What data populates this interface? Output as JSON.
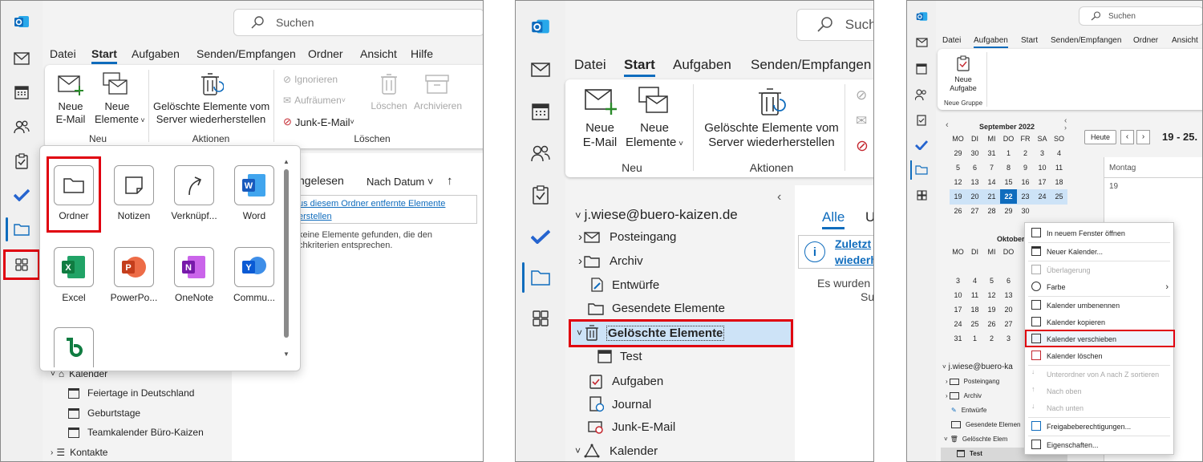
{
  "colors": {
    "accent": "#0f6cbd",
    "highlight": "#e0000f",
    "selected": "#cde3f7"
  },
  "panel1": {
    "search_placeholder": "Suchen",
    "tabs": [
      "Datei",
      "Start",
      "Aufgaben",
      "Senden/Empfangen",
      "Ordner",
      "Ansicht",
      "Hilfe"
    ],
    "ribbon": {
      "new_mail": [
        "Neue",
        "E-Mail"
      ],
      "new_items": [
        "Neue",
        "Elemente"
      ],
      "new_group": "Neu",
      "restore": [
        "Gelöschte Elemente vom",
        "Server wiederherstellen"
      ],
      "actions_group": "Aktionen",
      "ignore": "Ignorieren",
      "cleanup": "Aufräumen",
      "junk": "Junk-E-Mail",
      "delete": "Löschen",
      "archive": "Archivieren",
      "delete_group": "Löschen"
    },
    "list_header": {
      "unread": "ngelesen",
      "sort": "Nach Datum"
    },
    "info_link": [
      "us diesem Ordner entfernte Elemente",
      "erstellen"
    ],
    "empty_text": [
      "keine Elemente gefunden, die den",
      "chkriterien entsprechen."
    ],
    "tree": {
      "calendar": "Kalender",
      "items": [
        "Feiertage in Deutschland",
        "Geburtstage",
        "Teamkalender Büro-Kaizen"
      ],
      "contacts": "Kontakte"
    },
    "apps": [
      "Ordner",
      "Notizen",
      "Verknüpf...",
      "Word",
      "Excel",
      "PowerPo...",
      "OneNote",
      "Commu..."
    ]
  },
  "panel2": {
    "search_placeholder": "Suche",
    "tabs": [
      "Datei",
      "Start",
      "Aufgaben",
      "Senden/Empfangen"
    ],
    "ribbon": {
      "new_mail": [
        "Neue",
        "E-Mail"
      ],
      "new_items": [
        "Neue",
        "Elemente"
      ],
      "new_group": "Neu",
      "restore": [
        "Gelöschte Elemente vom",
        "Server wiederherstellen"
      ],
      "actions_group": "Aktionen"
    },
    "account": "j.wiese@buero-kaizen.de",
    "folders": [
      "Posteingang",
      "Archiv",
      "Entwürfe",
      "Gesendete Elemente",
      "Gelöschte Elemente",
      "Test",
      "Aufgaben",
      "Journal",
      "Junk-E-Mail",
      "Kalender"
    ],
    "filter_tabs": [
      "Alle",
      "U"
    ],
    "info": [
      "Zuletzt",
      "wiederh"
    ],
    "empty": [
      "Es wurden",
      "Su"
    ]
  },
  "panel3": {
    "search_placeholder": "Suchen",
    "tabs": [
      "Datei",
      "Aufgaben",
      "Start",
      "Senden/Empfangen",
      "Ordner",
      "Ansicht"
    ],
    "new_task": [
      "Neue",
      "Aufgabe"
    ],
    "group": "Neue Gruppe",
    "month1": "September 2022",
    "month2": "Oktober 20",
    "weekdays": [
      "MO",
      "DI",
      "MI",
      "DO",
      "FR",
      "SA",
      "SO"
    ],
    "weeks1": [
      [
        "29",
        "30",
        "31",
        "1",
        "2",
        "3",
        "4"
      ],
      [
        "5",
        "6",
        "7",
        "8",
        "9",
        "10",
        "11"
      ],
      [
        "12",
        "13",
        "14",
        "15",
        "16",
        "17",
        "18"
      ],
      [
        "19",
        "20",
        "21",
        "22",
        "23",
        "24",
        "25"
      ],
      [
        "26",
        "27",
        "28",
        "29",
        "30",
        "",
        ""
      ]
    ],
    "weeks2": [
      [
        "3",
        "4",
        "5",
        "6"
      ],
      [
        "10",
        "11",
        "12",
        "13"
      ],
      [
        "17",
        "18",
        "19",
        "20"
      ],
      [
        "24",
        "25",
        "26",
        "27"
      ],
      [
        "31",
        "1",
        "2",
        "3"
      ]
    ],
    "today": "Heute",
    "range": "19 - 25.",
    "day": "Montag",
    "daynum": "19",
    "account": "j.wiese@buero-ka",
    "folders": [
      "Posteingang",
      "Archiv",
      "Entwürfe",
      "Gesendete Elemen",
      "Gelöschte Elem",
      "Test"
    ],
    "menu": [
      "In neuem Fenster öffnen",
      "Neuer Kalender...",
      "Überlagerung",
      "Farbe",
      "Kalender umbenennen",
      "Kalender kopieren",
      "Kalender verschieben",
      "Kalender löschen",
      "Unterordner von A nach Z sortieren",
      "Nach oben",
      "Nach unten",
      "Freigabeberechtigungen...",
      "Eigenschaften..."
    ]
  }
}
